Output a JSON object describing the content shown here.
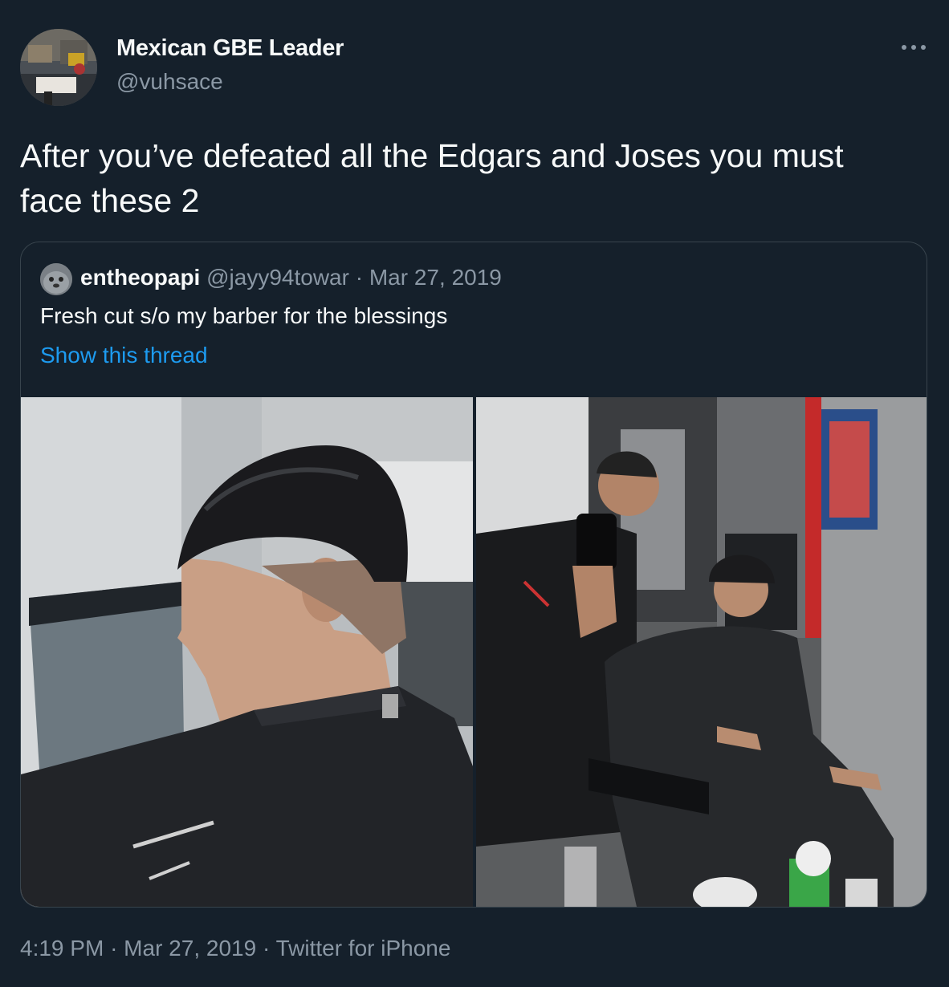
{
  "tweet": {
    "author_name": "Mexican GBE Leader",
    "author_handle": "@vuhsace",
    "more_icon": "more-horizontal-icon",
    "text": "After you’ve defeated all the Edgars and Joses you must face these 2",
    "time": "4:19 PM",
    "date": "Mar 27, 2019",
    "source": "Twitter for iPhone",
    "separator": "·"
  },
  "quoted": {
    "author_name": "entheopapi",
    "author_handle": "@jayy94towar",
    "date": "Mar 27, 2019",
    "separator": "·",
    "text": "Fresh cut s/o my barber for the blessings",
    "show_thread": "Show this thread",
    "photo_count": 2
  },
  "colors": {
    "background": "#15202b",
    "text_primary": "#f7f9f9",
    "text_secondary": "#8b98a5",
    "link": "#1d9bf0",
    "border": "#38444d"
  }
}
